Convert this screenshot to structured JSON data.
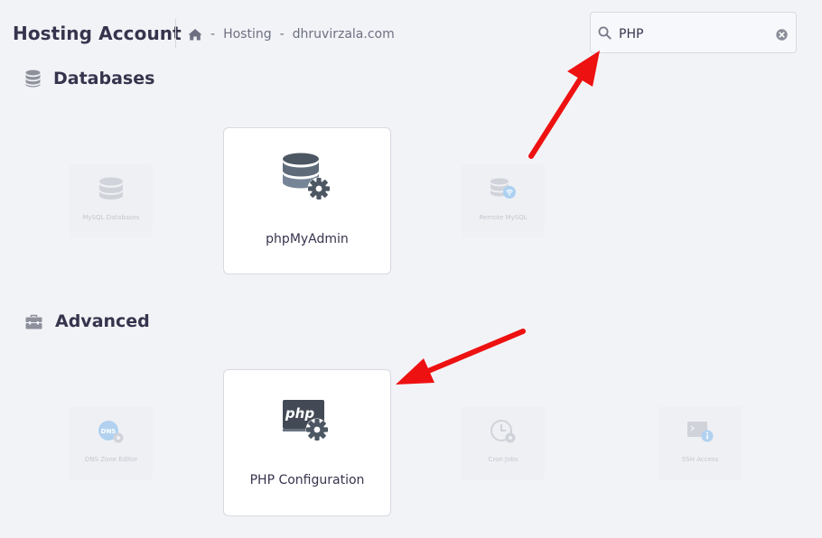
{
  "header": {
    "title": "Hosting Account",
    "breadcrumb": {
      "home_icon": "home-icon",
      "separator": "-",
      "items": [
        "Hosting",
        "dhruvirzala.com"
      ]
    }
  },
  "search": {
    "icon": "search-icon",
    "value": "PHP",
    "clear_icon": "clear-icon"
  },
  "sections": {
    "databases": {
      "title": "Databases",
      "icon": "database-icon",
      "tiles": [
        {
          "label": "MySQL Databases",
          "icon": "mysql-database-icon",
          "matched": false
        },
        {
          "label": "phpMyAdmin",
          "icon": "phpmyadmin-icon",
          "matched": true
        },
        {
          "label": "Remote MySQL",
          "icon": "remote-mysql-icon",
          "matched": false
        }
      ]
    },
    "advanced": {
      "title": "Advanced",
      "icon": "toolbox-icon",
      "tiles": [
        {
          "label": "DNS Zone Editor",
          "icon": "dns-zone-editor-icon",
          "matched": false
        },
        {
          "label": "PHP Configuration",
          "icon": "php-configuration-icon",
          "matched": true
        },
        {
          "label": "Cron Jobs",
          "icon": "cron-jobs-icon",
          "matched": false
        },
        {
          "label": "SSH Access",
          "icon": "ssh-access-icon",
          "matched": false
        }
      ]
    }
  },
  "colors": {
    "background": "#f2f3f7",
    "card": "#ffffff",
    "text": "#36344d",
    "muted": "#6d7081",
    "icon": "#5b6472",
    "annotation_arrow": "#ee1111"
  }
}
